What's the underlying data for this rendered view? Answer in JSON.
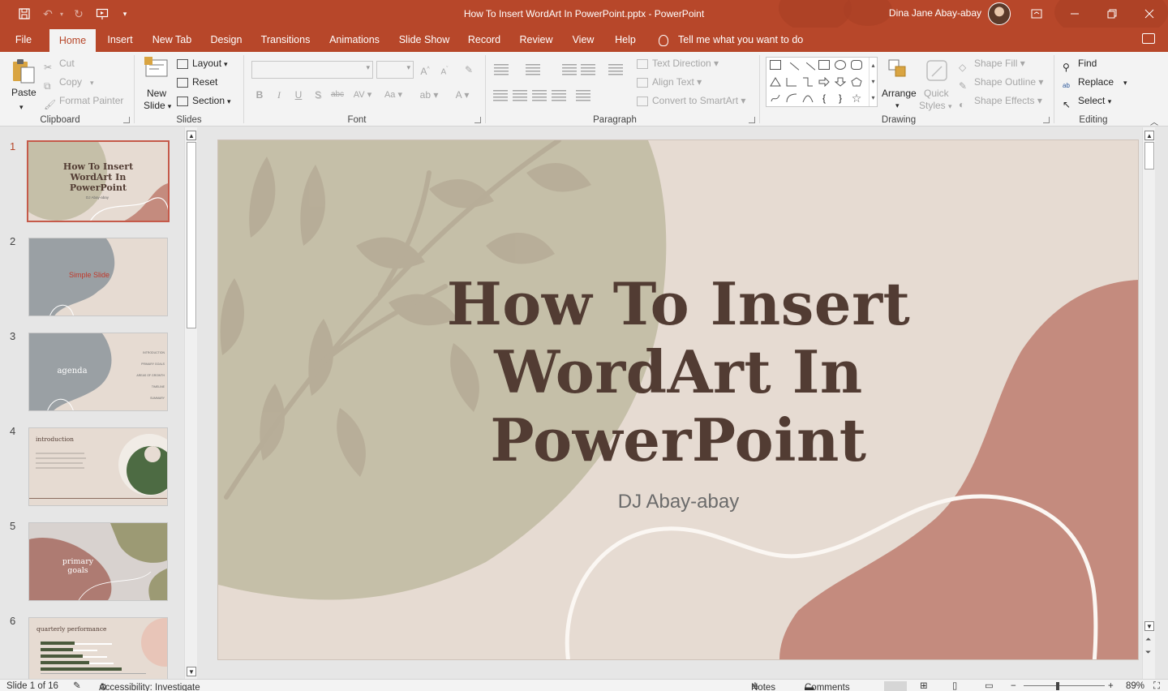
{
  "window": {
    "title": "How To Insert WordArt In PowerPoint.pptx  -  PowerPoint",
    "user": "Dina Jane Abay-abay",
    "brand_color": "#b7472a"
  },
  "quick_access": {
    "icons": [
      "save-icon",
      "undo-icon",
      "redo-icon",
      "present-from-start-icon",
      "customize-qat-icon"
    ]
  },
  "tabs": [
    "File",
    "Home",
    "Insert",
    "New Tab",
    "Design",
    "Transitions",
    "Animations",
    "Slide Show",
    "Record",
    "Review",
    "View",
    "Help"
  ],
  "tell_me": "Tell me what you want to do",
  "ribbon": {
    "clipboard": {
      "label": "Clipboard",
      "paste": "Paste",
      "cut": "Cut",
      "copy": "Copy",
      "format_painter": "Format Painter"
    },
    "slides": {
      "label": "Slides",
      "new_slide_1": "New",
      "new_slide_2": "Slide",
      "layout": "Layout",
      "reset": "Reset",
      "section": "Section"
    },
    "font": {
      "label": "Font",
      "bold": "B",
      "italic": "I",
      "underline": "U",
      "shadow": "S",
      "strike": "abc",
      "spacing": "AV",
      "case": "Aa",
      "grow": "A",
      "shrink": "A",
      "color": "A"
    },
    "paragraph": {
      "label": "Paragraph",
      "text_direction": "Text Direction",
      "align_text": "Align Text",
      "convert_smartart": "Convert to SmartArt"
    },
    "drawing": {
      "label": "Drawing",
      "arrange": "Arrange",
      "quick_styles_1": "Quick",
      "quick_styles_2": "Styles",
      "shape_fill": "Shape Fill",
      "shape_outline": "Shape Outline",
      "shape_effects": "Shape Effects"
    },
    "editing": {
      "label": "Editing",
      "find": "Find",
      "replace": "Replace",
      "select": "Select"
    }
  },
  "slides": [
    {
      "num": "1",
      "title": "How To Insert WordArt In PowerPoint",
      "sub": "DJ Abay-abay"
    },
    {
      "num": "2",
      "title": "Simple Slide"
    },
    {
      "num": "3",
      "title": "agenda",
      "items": [
        "INTRODUCTION",
        "PRIMARY GOALS",
        "AREAS OF GROWTH",
        "TIMELINE",
        "SUMMARY"
      ]
    },
    {
      "num": "4",
      "title": "introduction"
    },
    {
      "num": "5",
      "title": "primary goals"
    },
    {
      "num": "6",
      "title": "quarterly performance"
    }
  ],
  "current_slide": {
    "title_line1": "How To Insert",
    "title_line2": "WordArt In",
    "title_line3": "PowerPoint",
    "subtitle": "DJ Abay-abay",
    "colors": {
      "background": "#e6dbd2",
      "olive": "#c5bfa8",
      "rose": "#c48b7e",
      "title": "#523c33"
    }
  },
  "status": {
    "slide_of": "Slide 1 of 16",
    "accessibility": "Accessibility: Investigate",
    "notes": "Notes",
    "comments": "Comments",
    "zoom": "89%"
  }
}
